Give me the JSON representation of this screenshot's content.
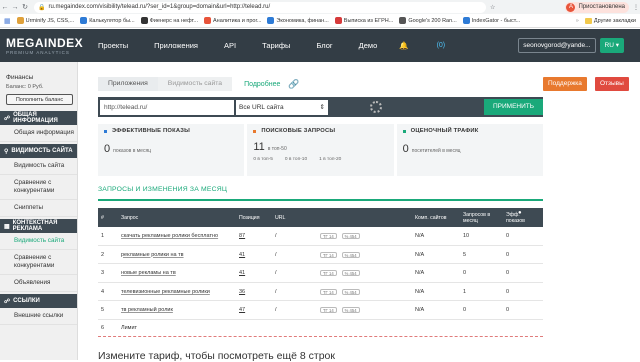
{
  "browser": {
    "url": "ru.megaindex.com/visibility/telead.ru/?ser_id=1&group=domain&url=http://telead.ru/",
    "profile_status": "Приостановлена",
    "profile_initial": "A",
    "bookmarks": [
      {
        "label": "Urminify JS, CSS,...",
        "color": "#e0a13a"
      },
      {
        "label": "Калькулятор бы...",
        "color": "#2e7bd6"
      },
      {
        "label": "Фиенерс на нефт...",
        "color": "#333333"
      },
      {
        "label": "Аналитика и прог...",
        "color": "#e8543a"
      },
      {
        "label": "Экономика, финан...",
        "color": "#2e7bd6"
      },
      {
        "label": "Выписка из ЕГРН...",
        "color": "#d63a3a"
      },
      {
        "label": "Google's 200 Ran...",
        "color": "#555555"
      },
      {
        "label": "IndexGator - быст...",
        "color": "#2e7bd6"
      }
    ],
    "other_bookmarks": "Другие закладки"
  },
  "header": {
    "logo": "MEGAINDEX",
    "logo_sub": "PREMIUM ANALYTICS",
    "nav": [
      "Проекты",
      "Приложения",
      "API",
      "Тарифы",
      "Блог",
      "Демо"
    ],
    "notifications": "(0)",
    "user_email": "seonovgorod@yande...",
    "lang": "RU"
  },
  "sidebar": {
    "finance_label": "Финансы",
    "balance": "Баланс: 0 Руб.",
    "topup": "Пополнить баланс",
    "sections": [
      {
        "title": "ОБЩАЯ ИНФОРМАЦИЯ",
        "items": [
          "Общая информация"
        ]
      },
      {
        "title": "ВИДИМОСТЬ САЙТА",
        "items": [
          "Видимость сайта",
          "Сравнение с конкурентами",
          "Сниппеты"
        ]
      },
      {
        "title": "КОНТЕКСТНАЯ РЕКЛАМА",
        "items": [
          "Видимость сайта",
          "Сравнение с конкурентами",
          "Объявления"
        ]
      },
      {
        "title": "ССЫЛКИ",
        "items": [
          "Внешние ссылки"
        ]
      }
    ]
  },
  "toolbar": {
    "tab_apps": "Приложения",
    "tab_visibility": "Видимость сайта",
    "more": "Подробнее",
    "support": "Поддержка",
    "reviews": "Отзывы"
  },
  "search": {
    "url_value": "http://telead.ru/",
    "select_value": "Все URL сайта",
    "apply": "ПРИМЕНИТЬ"
  },
  "cards": [
    {
      "title": "ЭФФЕКТИВНЫЕ ПОКАЗЫ",
      "color": "#2e7bd6",
      "value": "0",
      "unit": "показов в месяц",
      "sub": []
    },
    {
      "title": "ПОИСКОВЫЕ ЗАПРОСЫ",
      "color": "#e8792e",
      "value": "11",
      "unit": "в топ-50",
      "sub": [
        "0 в топ-5",
        "0 в топ-10",
        "1 в топ-20"
      ]
    },
    {
      "title": "ОЦЕНОЧНЫЙ ТРАФИК",
      "color": "#1aa97a",
      "value": "0",
      "unit": "посетителей в месяц",
      "sub": []
    }
  ],
  "table": {
    "title": "ЗАПРОСЫ И ИЗМЕНЕНИЯ ЗА МЕСЯЦ",
    "headers": {
      "num": "#",
      "query": "Запрос",
      "position": "Позиция",
      "url": "URL",
      "competitors": "Комп. сайтов",
      "requests": "Запросов в месяц",
      "efficiency": "Эфф. показов"
    },
    "rows": [
      {
        "num": "1",
        "query": "скачать рекламные ролики бесплатно",
        "position": "87",
        "url": "/",
        "competitors": "N/A",
        "requests": "10",
        "efficiency": "0"
      },
      {
        "num": "2",
        "query": "рекламные ролики на тв",
        "position": "41",
        "url": "/",
        "competitors": "N/A",
        "requests": "5",
        "efficiency": "0"
      },
      {
        "num": "3",
        "query": "новые рекламы на тв",
        "position": "41",
        "url": "/",
        "competitors": "N/A",
        "requests": "0",
        "efficiency": "0"
      },
      {
        "num": "4",
        "query": "телевизионные рекламные ролики",
        "position": "36",
        "url": "/",
        "competitors": "N/A",
        "requests": "1",
        "efficiency": "0"
      },
      {
        "num": "5",
        "query": "тв рекламный ролик",
        "position": "47",
        "url": "/",
        "competitors": "N/A",
        "requests": "0",
        "efficiency": "0"
      }
    ],
    "pill_a": "ТГ 14",
    "pill_b": "% 454",
    "limit_num": "6",
    "limit_label": "Лимит"
  },
  "upgrade_text": "Измените тариф, чтобы посмотреть ещё 8 строк"
}
